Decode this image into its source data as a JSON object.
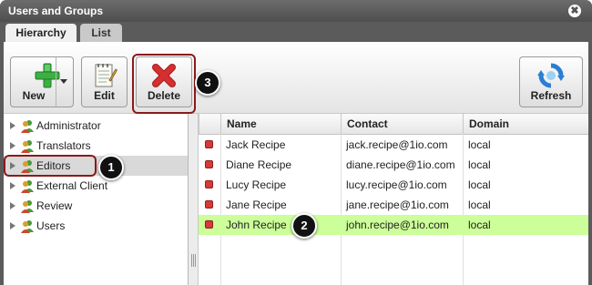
{
  "window": {
    "title": "Users and Groups",
    "close_glyph": "✖"
  },
  "tabs": [
    {
      "label": "Hierarchy",
      "active": true
    },
    {
      "label": "List",
      "active": false
    }
  ],
  "toolbar": {
    "new_label": "New",
    "edit_label": "Edit",
    "delete_label": "Delete",
    "refresh_label": "Refresh",
    "icons": {
      "new": "plus-icon",
      "edit": "notepad-icon",
      "delete": "red-x-icon",
      "refresh": "refresh-icon"
    }
  },
  "callouts": {
    "editors": "1",
    "row": "2",
    "delete": "3"
  },
  "tree": {
    "items": [
      {
        "label": "Administrator",
        "selected": false
      },
      {
        "label": "Translators",
        "selected": false
      },
      {
        "label": "Editors",
        "selected": true
      },
      {
        "label": "External Client",
        "selected": false
      },
      {
        "label": "Review",
        "selected": false
      },
      {
        "label": "Users",
        "selected": false
      }
    ]
  },
  "grid": {
    "columns": [
      "Name",
      "Contact",
      "Domain"
    ],
    "rows": [
      {
        "name": "Jack Recipe",
        "contact": "jack.recipe@1io.com",
        "domain": "local",
        "highlighted": false
      },
      {
        "name": "Diane Recipe",
        "contact": "diane.recipe@1io.com",
        "domain": "local",
        "highlighted": false
      },
      {
        "name": "Lucy Recipe",
        "contact": "lucy.recipe@1io.com",
        "domain": "local",
        "highlighted": false
      },
      {
        "name": "Jane Recipe",
        "contact": "jane.recipe@1io.com",
        "domain": "local",
        "highlighted": false
      },
      {
        "name": "John Recipe",
        "contact": "john.recipe@1io.com",
        "domain": "local",
        "highlighted": true
      }
    ]
  },
  "colors": {
    "highlight_row": "#ccff99",
    "callout_border": "#8b1a1a",
    "user_icon_red": "#d8383a",
    "new_icon_green": "#3cb043",
    "delete_icon_red": "#d62f2f"
  }
}
